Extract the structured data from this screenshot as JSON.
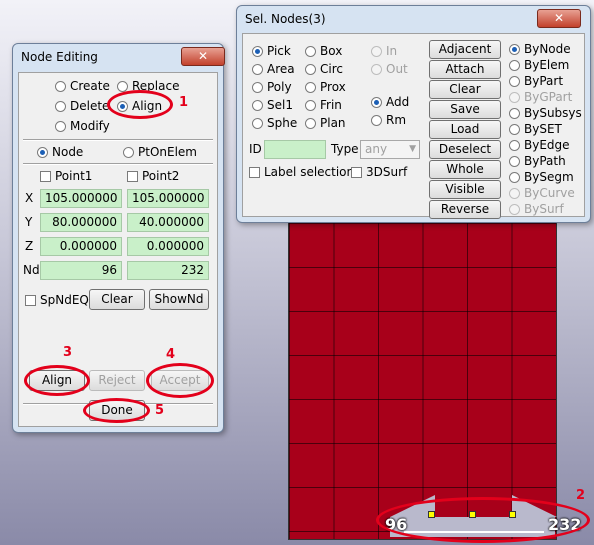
{
  "viewport": {
    "node_left_label": "96",
    "node_right_label": "232",
    "annotation_2": "2"
  },
  "node_editing": {
    "title": "Node Editing",
    "close_label": "✕",
    "modes": [
      {
        "label": "Create",
        "checked": false
      },
      {
        "label": "Replace",
        "checked": false
      },
      {
        "label": "Delete",
        "checked": false
      },
      {
        "label": "Align",
        "checked": true
      },
      {
        "label": "Modify",
        "checked": false
      }
    ],
    "annotation_1": "1",
    "target_options": [
      {
        "label": "Node",
        "checked": true
      },
      {
        "label": "PtOnElem",
        "checked": false
      }
    ],
    "point1_label": "Point1",
    "point2_label": "Point2",
    "rows": [
      {
        "label": "X",
        "p1": "105.000000",
        "p2": "105.000000"
      },
      {
        "label": "Y",
        "p1": "80.000000",
        "p2": "40.000000"
      },
      {
        "label": "Z",
        "p1": "0.000000",
        "p2": "0.000000"
      },
      {
        "label": "Nd",
        "p1": "96",
        "p2": "232"
      }
    ],
    "spndeq_label": "SpNdEQ",
    "clear_label": "Clear",
    "shownd_label": "ShowNd",
    "align_label": "Align",
    "reject_label": "Reject",
    "accept_label": "Accept",
    "done_label": "Done",
    "annotation_3": "3",
    "annotation_4": "4",
    "annotation_5": "5"
  },
  "sel_nodes": {
    "title": "Sel. Nodes(3)",
    "close_label": "✕",
    "pick_col1": [
      "Pick",
      "Area",
      "Poly",
      "Sel1",
      "Sphe"
    ],
    "pick_col2": [
      "Box",
      "Circ",
      "Prox",
      "Frin",
      "Plan"
    ],
    "in_label": "In",
    "out_label": "Out",
    "add_label": "Add",
    "rm_label": "Rm",
    "id_label": "ID",
    "type_label": "Type",
    "type_value": "any",
    "label_selection": "Label selection",
    "threed_surf": "3DSurf",
    "buttons": [
      "Adjacent",
      "Attach",
      "Clear",
      "Save",
      "Load",
      "Deselect",
      "Whole",
      "Visible",
      "Reverse"
    ],
    "by_options": [
      {
        "label": "ByNode",
        "checked": true,
        "enabled": true
      },
      {
        "label": "ByElem",
        "checked": false,
        "enabled": true
      },
      {
        "label": "ByPart",
        "checked": false,
        "enabled": true
      },
      {
        "label": "ByGPart",
        "checked": false,
        "enabled": false
      },
      {
        "label": "BySubsys",
        "checked": false,
        "enabled": true
      },
      {
        "label": "BySET",
        "checked": false,
        "enabled": true
      },
      {
        "label": "ByEdge",
        "checked": false,
        "enabled": true
      },
      {
        "label": "ByPath",
        "checked": false,
        "enabled": true
      },
      {
        "label": "BySegm",
        "checked": false,
        "enabled": true
      },
      {
        "label": "ByCurve",
        "checked": false,
        "enabled": false
      },
      {
        "label": "BySurf",
        "checked": false,
        "enabled": false
      }
    ]
  },
  "colors": {
    "mesh_fill": "#a8001a",
    "annotation_red": "#e3001b",
    "field_green": "#c9f0c9"
  }
}
